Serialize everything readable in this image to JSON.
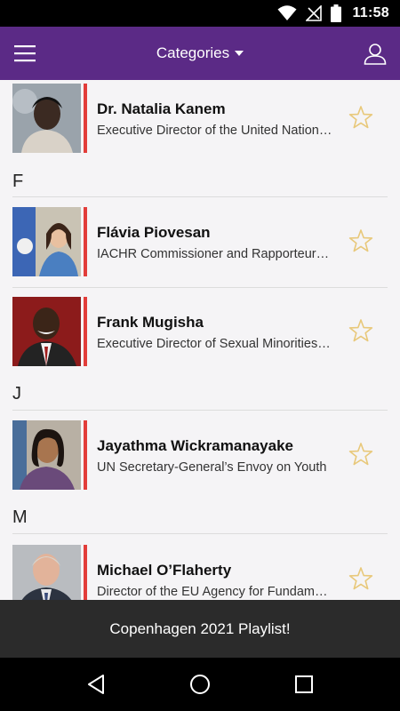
{
  "status_bar": {
    "time": "11:58",
    "icons": [
      "wifi-icon",
      "no-signal-icon",
      "battery-icon"
    ]
  },
  "app_bar": {
    "title": "Categories",
    "menu_icon": "hamburger-menu-icon",
    "dropdown_icon": "caret-down-icon",
    "profile_icon": "user-profile-icon"
  },
  "colors": {
    "app_bar": "#5b2a86",
    "accent": "#e23d3a",
    "star": "#e8c87a",
    "banner": "#2b2b2b"
  },
  "people": [
    {
      "name": "Dr. Natalia Kanem",
      "role": "Executive Director of the United Nations Population Fund"
    },
    {
      "name": "Flávia Piovesan",
      "role": "IACHR Commissioner and Rapporteur on LGBTI rights"
    },
    {
      "name": "Frank Mugisha",
      "role": "Executive Director of Sexual Minorities Uganda"
    },
    {
      "name": "Jayathma Wickramanayake",
      "role": "UN Secretary-General’s Envoy on Youth"
    },
    {
      "name": "Michael O’Flaherty",
      "role": "Director of the EU Agency for Fundamental Rights"
    }
  ],
  "section_letters": [
    "F",
    "J",
    "M"
  ],
  "banner": {
    "label": "Copenhagen 2021 Playlist!"
  },
  "nav_bar": {
    "icons": [
      "back-icon",
      "home-icon",
      "recents-icon"
    ]
  }
}
